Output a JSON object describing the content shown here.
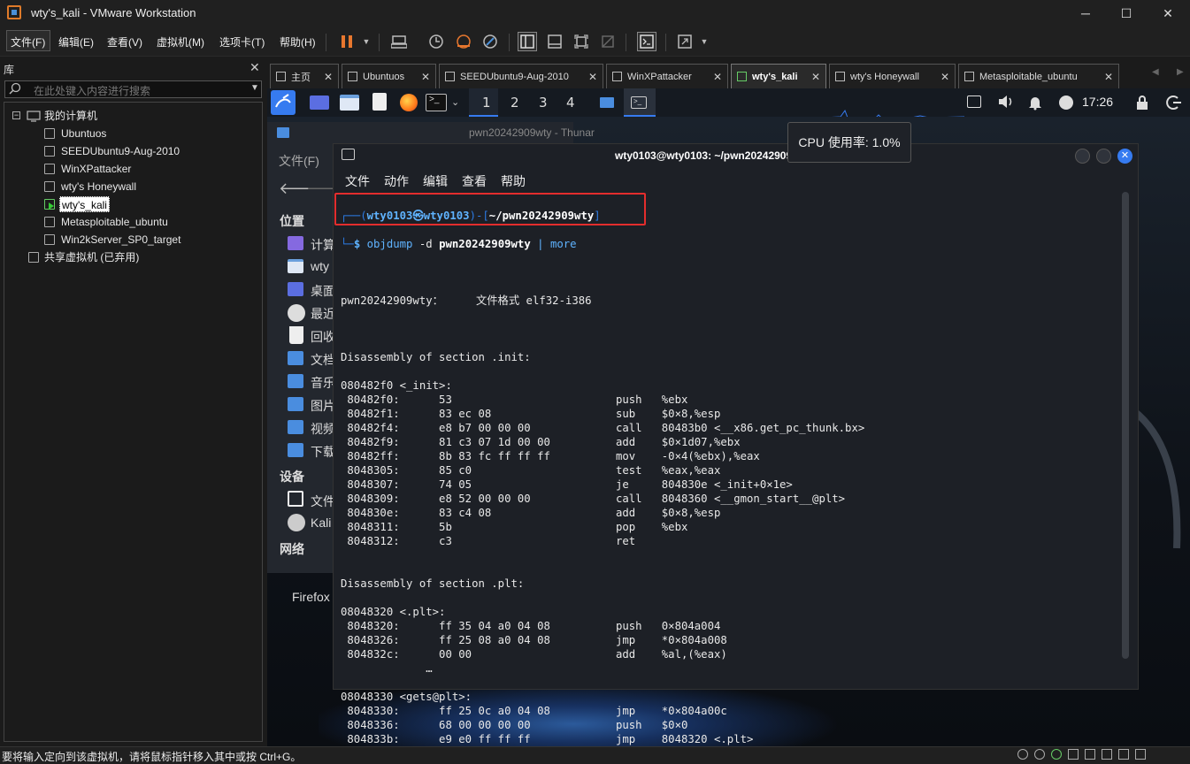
{
  "window": {
    "title": "wty's_kali - VMware Workstation",
    "minimize": "─",
    "maximize": "☐",
    "close": "✕"
  },
  "menubar": [
    "文件(F)",
    "编辑(E)",
    "查看(V)",
    "虚拟机(M)",
    "选项卡(T)",
    "帮助(H)"
  ],
  "library": {
    "title": "库",
    "close": "✕",
    "search_placeholder": "在此处键入内容进行搜索",
    "root": "我的计算机",
    "vms": [
      "Ubuntuos",
      "SEEDUbuntu9-Aug-2010",
      "WinXPattacker",
      "wty's Honeywall",
      "wty's_kali",
      "Metasploitable_ubuntu",
      "Win2kServer_SP0_target"
    ],
    "selected_vm": "wty's_kali",
    "shared": "共享虚拟机 (已弃用)"
  },
  "tabs": [
    {
      "label": "主页",
      "active": false
    },
    {
      "label": "Ubuntuos",
      "active": false
    },
    {
      "label": "SEEDUbuntu9-Aug-2010",
      "active": false
    },
    {
      "label": "WinXPattacker",
      "active": false
    },
    {
      "label": "wty's_kali",
      "active": true
    },
    {
      "label": "wty's Honeywall",
      "active": false
    },
    {
      "label": "Metasploitable_ubuntu",
      "active": false
    }
  ],
  "kali_panel": {
    "workspaces": [
      "1",
      "2",
      "3",
      "4"
    ],
    "clock": "17:26"
  },
  "tooltip": "CPU 使用率: 1.0%",
  "thunar": {
    "title": "pwn20242909wty - Thunar",
    "menu": "文件(F)",
    "places_header": "位置",
    "places": [
      "计算",
      "wty",
      "桌面",
      "最近",
      "回收",
      "文档",
      "音乐",
      "图片",
      "视频",
      "下载"
    ],
    "devices_header": "设备",
    "devices": [
      "文件",
      "Kali"
    ],
    "network_header": "网络"
  },
  "desktop": {
    "firefox_label": "Firefox ESR"
  },
  "terminal": {
    "title": "wty0103@wty0103: ~/pwn20242909wty",
    "menu": [
      "文件",
      "动作",
      "编辑",
      "查看",
      "帮助"
    ],
    "prompt_user": "wty0103㉿wty0103",
    "prompt_path": "~/pwn20242909wty",
    "command": "objdump",
    "command_args": " -d ",
    "command_file": "pwn20242909wty",
    "command_pipe": " | ",
    "command_more": "more",
    "file_format_line": "pwn20242909wty：     文件格式 elf32-i386",
    "sections": [
      {
        "header": "Disassembly of section .init:",
        "blocks": [
          {
            "label": "080482f0 <_init>:",
            "lines": [
              [
                " 80482f0:",
                "53",
                "push",
                "%ebx"
              ],
              [
                " 80482f1:",
                "83 ec 08",
                "sub",
                "$0×8,%esp"
              ],
              [
                " 80482f4:",
                "e8 b7 00 00 00",
                "call",
                "80483b0 <__x86.get_pc_thunk.bx>"
              ],
              [
                " 80482f9:",
                "81 c3 07 1d 00 00",
                "add",
                "$0×1d07,%ebx"
              ],
              [
                " 80482ff:",
                "8b 83 fc ff ff ff",
                "mov",
                "-0×4(%ebx),%eax"
              ],
              [
                " 8048305:",
                "85 c0",
                "test",
                "%eax,%eax"
              ],
              [
                " 8048307:",
                "74 05",
                "je",
                "804830e <_init+0×1e>"
              ],
              [
                " 8048309:",
                "e8 52 00 00 00",
                "call",
                "8048360 <__gmon_start__@plt>"
              ],
              [
                " 804830e:",
                "83 c4 08",
                "add",
                "$0×8,%esp"
              ],
              [
                " 8048311:",
                "5b",
                "pop",
                "%ebx"
              ],
              [
                " 8048312:",
                "c3",
                "ret",
                ""
              ]
            ]
          }
        ]
      },
      {
        "header": "Disassembly of section .plt:",
        "blocks": [
          {
            "label": "08048320 <.plt>:",
            "lines": [
              [
                " 8048320:",
                "ff 35 04 a0 04 08",
                "push",
                "0×804a004"
              ],
              [
                " 8048326:",
                "ff 25 08 a0 04 08",
                "jmp",
                "*0×804a008"
              ],
              [
                " 804832c:",
                "00 00",
                "add",
                "%al,(%eax)"
              ],
              [
                "",
                "   …",
                "",
                ""
              ]
            ]
          },
          {
            "label": "08048330 <gets@plt>:",
            "lines": [
              [
                " 8048330:",
                "ff 25 0c a0 04 08",
                "jmp",
                "*0×804a00c"
              ],
              [
                " 8048336:",
                "68 00 00 00 00",
                "push",
                "$0×0"
              ],
              [
                " 804833b:",
                "e9 e0 ff ff ff",
                "jmp",
                "8048320 <.plt>"
              ]
            ]
          }
        ]
      }
    ]
  },
  "statusbar": "要将输入定向到该虚拟机，请将鼠标指针移入其中或按 Ctrl+G。",
  "colors": {
    "prompt_blue": "#5fb3ff",
    "prompt_frame": "#2c7be5",
    "highlight_red": "#e32d2d",
    "kali_blue": "#367bf0"
  }
}
